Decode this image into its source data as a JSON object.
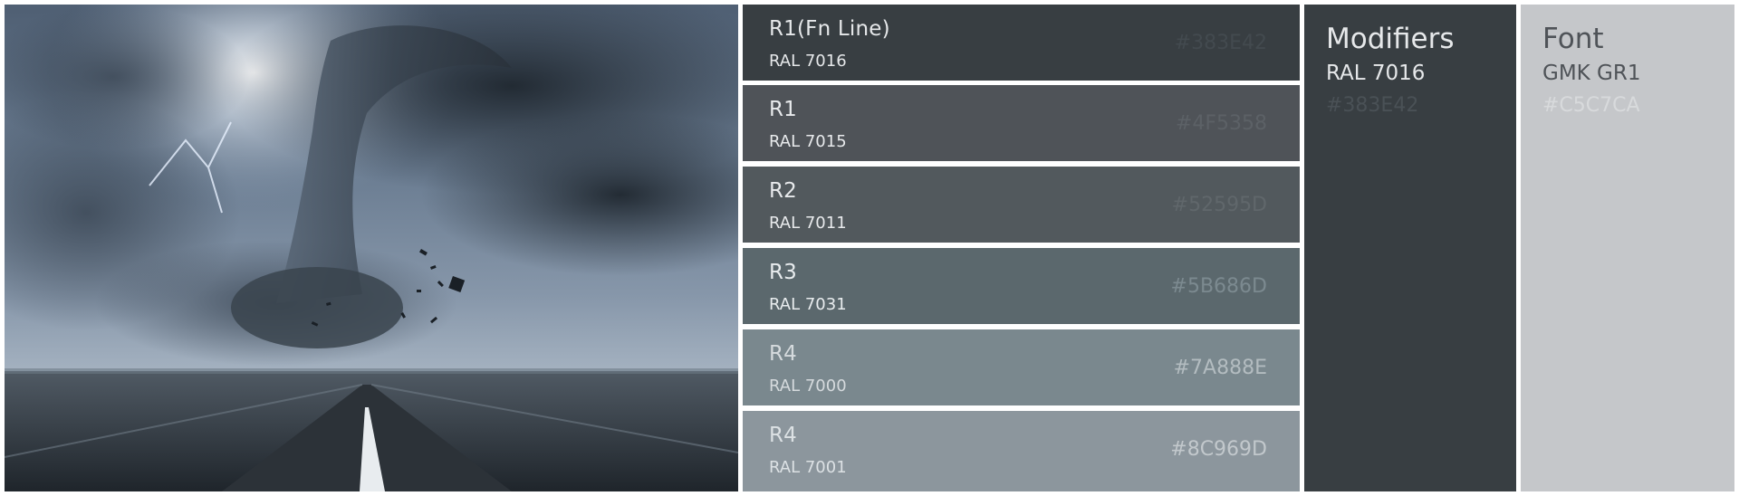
{
  "photo": {
    "description_icon": "tornado-photo"
  },
  "rows": [
    {
      "title": "R1(Fn Line)",
      "ral": "RAL 7016",
      "hex": "#383E42",
      "bg": "#383E42",
      "text": "#e6e8ea",
      "hexcolor": "#434a4f"
    },
    {
      "title": "R1",
      "ral": "RAL 7015",
      "hex": "#4F5358",
      "bg": "#4F5358",
      "text": "#e8eaec",
      "hexcolor": "#5c6166"
    },
    {
      "title": "R2",
      "ral": "RAL 7011",
      "hex": "#52595D",
      "bg": "#52595D",
      "text": "#e8eaec",
      "hexcolor": "#60676b"
    },
    {
      "title": "R3",
      "ral": "RAL 7031",
      "hex": "#5B686D",
      "bg": "#5B686D",
      "text": "#e8ecee",
      "hexcolor": "#7c8a90"
    },
    {
      "title": "R4",
      "ral": "RAL 7000",
      "hex": "#7A888E",
      "bg": "#7A888E",
      "text": "#d5dadd",
      "hexcolor": "#b3bcc0"
    },
    {
      "title": "R4",
      "ral": "RAL 7001",
      "hex": "#8C969D",
      "bg": "#8C969D",
      "text": "#dce1e4",
      "hexcolor": "#c2c8cc"
    }
  ],
  "modifiers": {
    "title": "Modifiers",
    "ral": "RAL 7016",
    "hex": "#383E42",
    "bg": "#383E42"
  },
  "font": {
    "title": "Font",
    "name": "GMK GR1",
    "hex": "#C5C7CA",
    "bg": "#C5C7CA"
  }
}
